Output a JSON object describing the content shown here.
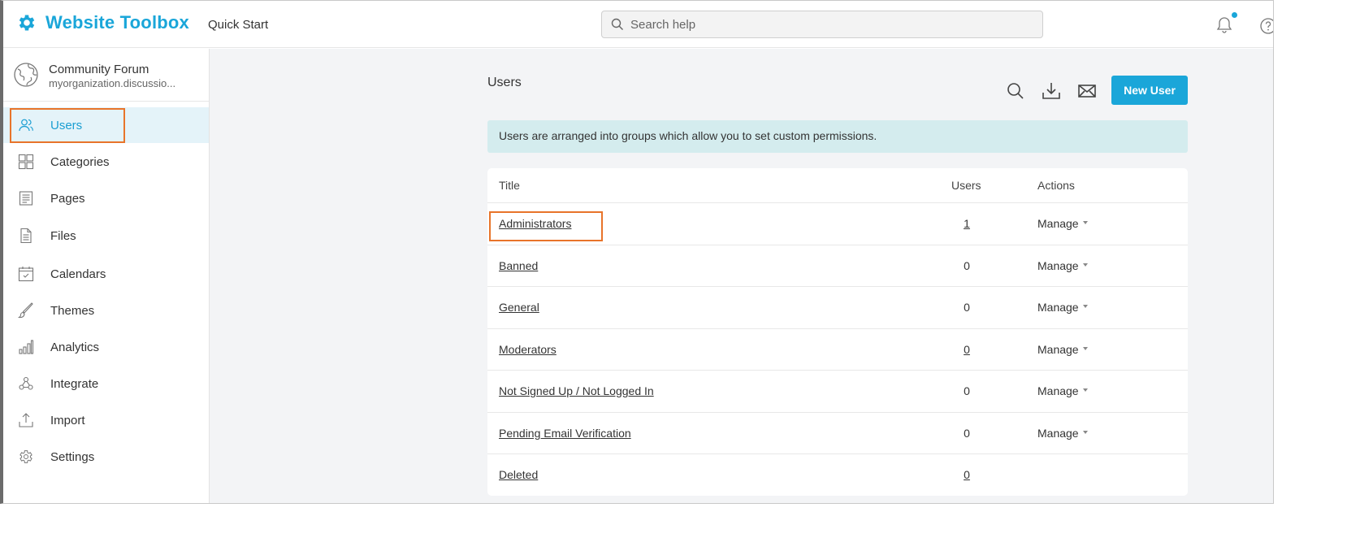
{
  "header": {
    "brand": "Website Toolbox",
    "quick_start": "Quick Start",
    "search_placeholder": "Search help",
    "brand_color": "#1aa6d9",
    "icons": [
      "gear-icon",
      "search-icon",
      "bell-icon",
      "help-icon"
    ]
  },
  "sidebar": {
    "org_title": "Community Forum",
    "org_url": "myorganization.discussio...",
    "items": [
      {
        "label": "Users",
        "icon": "users-icon",
        "active": true
      },
      {
        "label": "Categories",
        "icon": "grid-icon",
        "active": false
      },
      {
        "label": "Pages",
        "icon": "page-icon",
        "active": false
      },
      {
        "label": "Files",
        "icon": "file-icon",
        "active": false
      },
      {
        "label": "Calendars",
        "icon": "calendar-icon",
        "active": false
      },
      {
        "label": "Themes",
        "icon": "brush-icon",
        "active": false
      },
      {
        "label": "Analytics",
        "icon": "bar-chart-icon",
        "active": false
      },
      {
        "label": "Integrate",
        "icon": "webhook-icon",
        "active": false
      },
      {
        "label": "Import",
        "icon": "upload-icon",
        "active": false
      },
      {
        "label": "Settings",
        "icon": "gear-icon",
        "active": false
      }
    ]
  },
  "main": {
    "title": "Users",
    "new_user_label": "New User",
    "info_text": "Users are arranged into groups which allow you to set custom permissions.",
    "table": {
      "headers": {
        "title": "Title",
        "users": "Users",
        "actions": "Actions"
      },
      "rows": [
        {
          "title": "Administrators",
          "users": "1",
          "users_link": true,
          "action": "Manage"
        },
        {
          "title": "Banned",
          "users": "0",
          "users_link": false,
          "action": "Manage"
        },
        {
          "title": "General",
          "users": "0",
          "users_link": false,
          "action": "Manage"
        },
        {
          "title": "Moderators",
          "users": "0",
          "users_link": true,
          "action": "Manage"
        },
        {
          "title": "Not Signed Up / Not Logged In",
          "users": "0",
          "users_link": false,
          "action": "Manage"
        },
        {
          "title": "Pending Email Verification",
          "users": "0",
          "users_link": false,
          "action": "Manage"
        },
        {
          "title": "Deleted",
          "users": "0",
          "users_link": true,
          "action": ""
        }
      ]
    }
  },
  "highlight_color": "#e8742a"
}
